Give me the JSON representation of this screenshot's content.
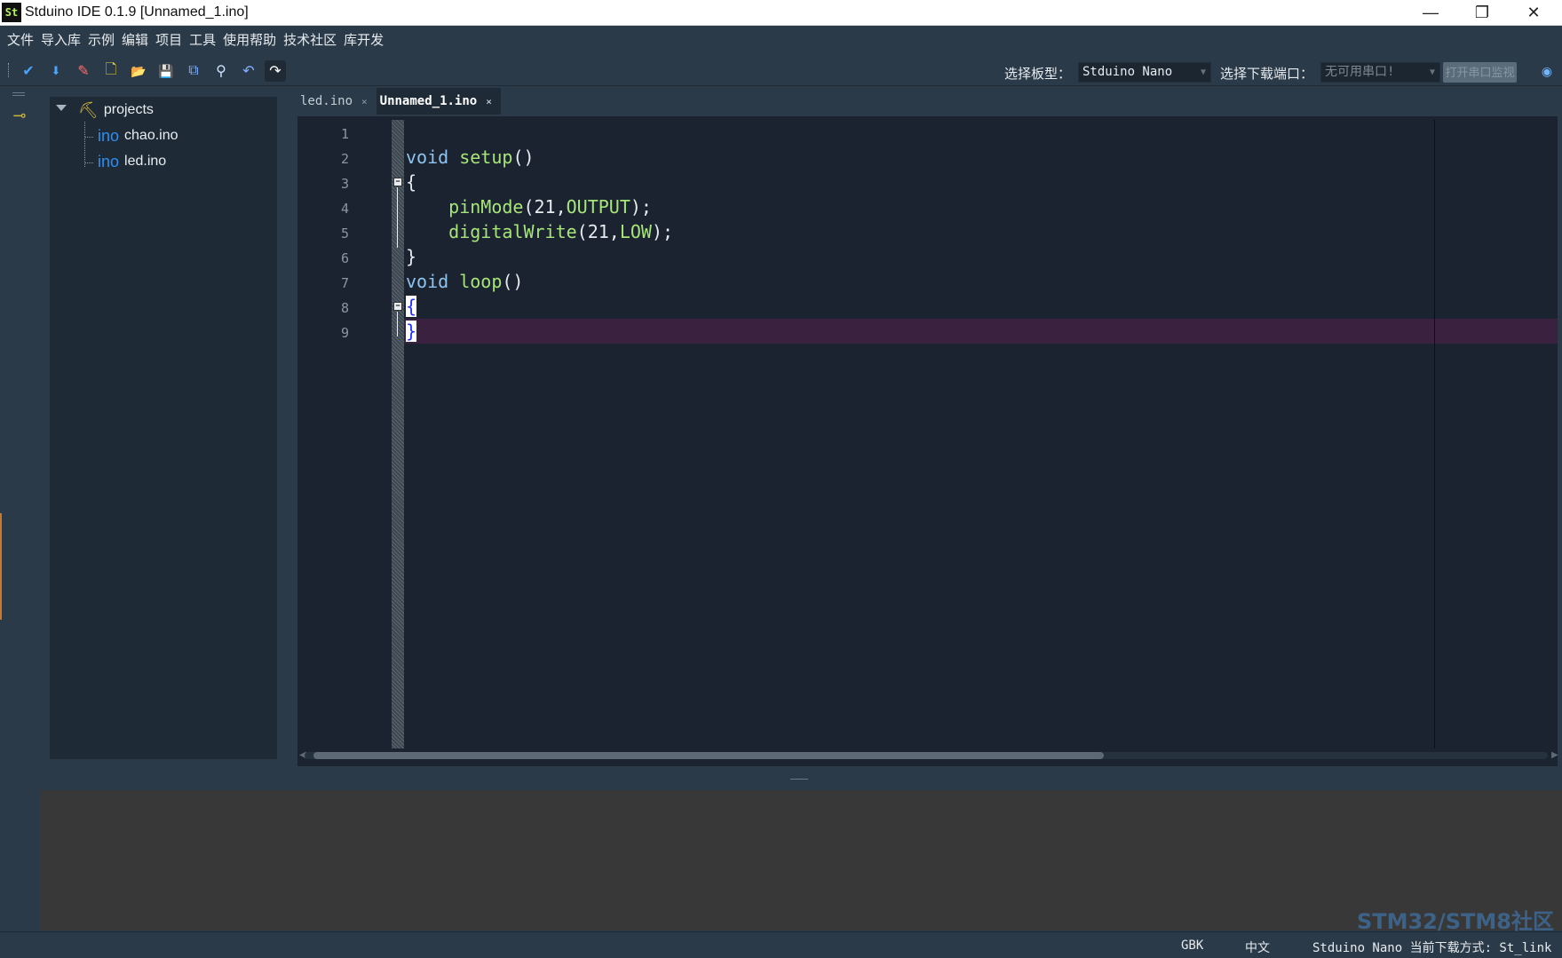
{
  "window": {
    "title": "Stduino IDE 0.1.9 [Unnamed_1.ino]",
    "logo_text": "St",
    "minimize_glyph": "—",
    "maximize_glyph": "❐",
    "close_glyph": "✕"
  },
  "menu": [
    "文件",
    "导入库",
    "示例",
    "编辑",
    "项目",
    "工具",
    "使用帮助",
    "技术社区",
    "库开发"
  ],
  "toolbar": {
    "buttons": [
      {
        "name": "verify-icon",
        "glyph": "✔",
        "color": "#4aa3ff"
      },
      {
        "name": "upload-icon",
        "glyph": "⬇",
        "color": "#4aa3ff"
      },
      {
        "name": "eraser-icon",
        "glyph": "✎",
        "color": "#ff6b6b"
      },
      {
        "name": "new-file-icon",
        "glyph": "🗋",
        "color": "#f2d03b"
      },
      {
        "name": "open-folder-icon",
        "glyph": "📂",
        "color": "#f2c04b"
      },
      {
        "name": "save-icon",
        "glyph": "💾",
        "color": "#7fb0ff"
      },
      {
        "name": "save-all-icon",
        "glyph": "⧉",
        "color": "#7fb0ff"
      },
      {
        "name": "find-icon",
        "glyph": "⚲",
        "color": "#cfe3ff"
      },
      {
        "name": "undo-icon",
        "glyph": "↶",
        "color": "#7fb0ff"
      },
      {
        "name": "redo-icon",
        "glyph": "↷",
        "color": "#ffffff"
      }
    ],
    "board_label": "选择板型：",
    "board_value": "Stduino Nano",
    "port_label": "选择下载端口：",
    "port_value": "无可用串口!",
    "upload_button": "打开串口监视"
  },
  "project_tree": {
    "root": "projects",
    "files": [
      {
        "tag": "ino",
        "name": "chao.ino"
      },
      {
        "tag": "ino",
        "name": "led.ino"
      }
    ]
  },
  "tabs": [
    {
      "label": "led.ino",
      "close": "×",
      "active": false
    },
    {
      "label": "Unnamed_1.ino",
      "close": "×",
      "active": true
    }
  ],
  "editor": {
    "line_numbers": [
      "1",
      "2",
      "3",
      "4",
      "5",
      "6",
      "7",
      "8",
      "9"
    ],
    "code": {
      "l2_kw": "void",
      "l2_fn": "setup",
      "l2_rest": "()",
      "l3": "{",
      "l4_fn": "pinMode",
      "l4_open": "(21,",
      "l4_const": "OUTPUT",
      "l4_close": ");",
      "l5_fn": "digitalWrite",
      "l5_open": "(21,",
      "l5_const": "LOW",
      "l5_close": ");",
      "l6": "}",
      "l7_kw": "void",
      "l7_fn": "loop",
      "l7_rest": "()",
      "l8": "{",
      "l9": "}"
    },
    "fold_glyph": "−"
  },
  "status": {
    "encoding": "GBK",
    "language": "中文",
    "board_info": "Stduino Nano 当前下载方式: St_link"
  },
  "watermark": "STM32/STM8社区"
}
